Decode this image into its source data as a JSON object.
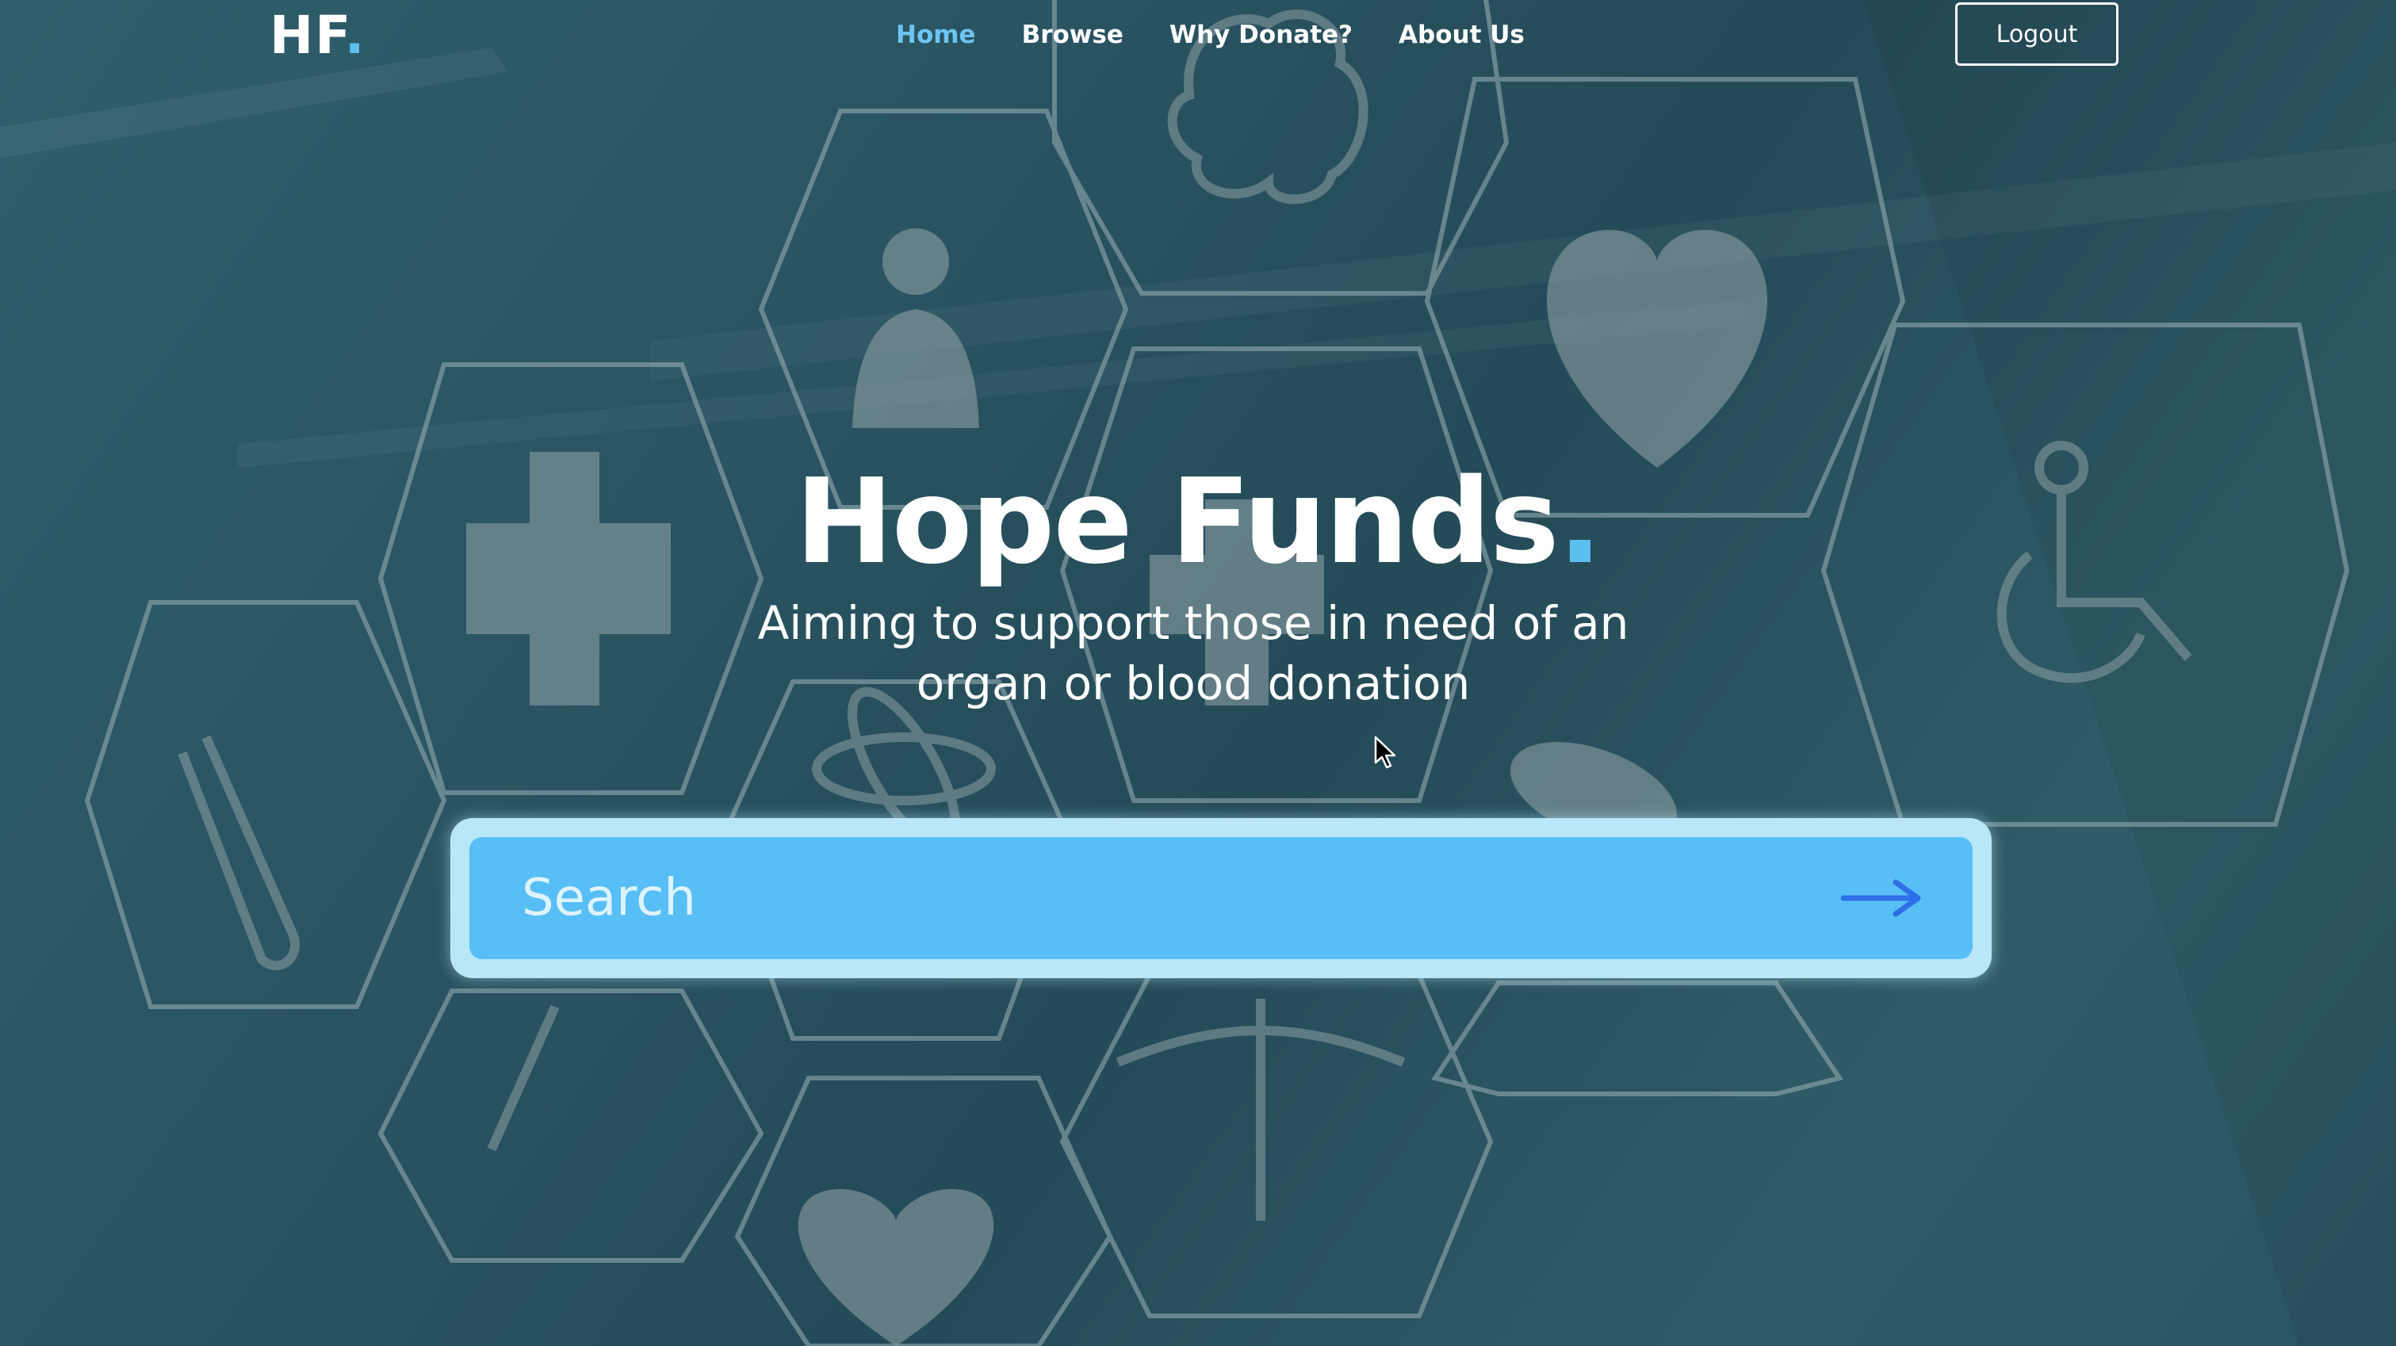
{
  "brand": {
    "logo_text": "HF",
    "logo_dot": "."
  },
  "nav": {
    "items": [
      {
        "label": "Home",
        "active": true
      },
      {
        "label": "Browse",
        "active": false
      },
      {
        "label": "Why Donate?",
        "active": false
      },
      {
        "label": "About Us",
        "active": false
      }
    ],
    "logout_label": "Logout"
  },
  "hero": {
    "title": "Hope Funds",
    "title_dot": ".",
    "subtitle_line1": "Aiming to support those in need of an",
    "subtitle_line2": "organ or blood donation"
  },
  "search": {
    "placeholder": "Search",
    "value": "",
    "submit_icon": "arrow-right-icon"
  },
  "colors": {
    "accent": "#5bc0f0",
    "search_fill": "#58bff6",
    "search_border": "#b9e7f7",
    "arrow": "#2f6fe8",
    "background": "#2a5562"
  },
  "background_icons": [
    "brain-icon",
    "person-icon",
    "heart-pulse-icon",
    "medical-cross-icon",
    "wheelchair-icon",
    "test-tube-icon",
    "syringe-icon",
    "caduceus-icon",
    "pill-icon",
    "heart-cross-icon",
    "atom-icon"
  ]
}
